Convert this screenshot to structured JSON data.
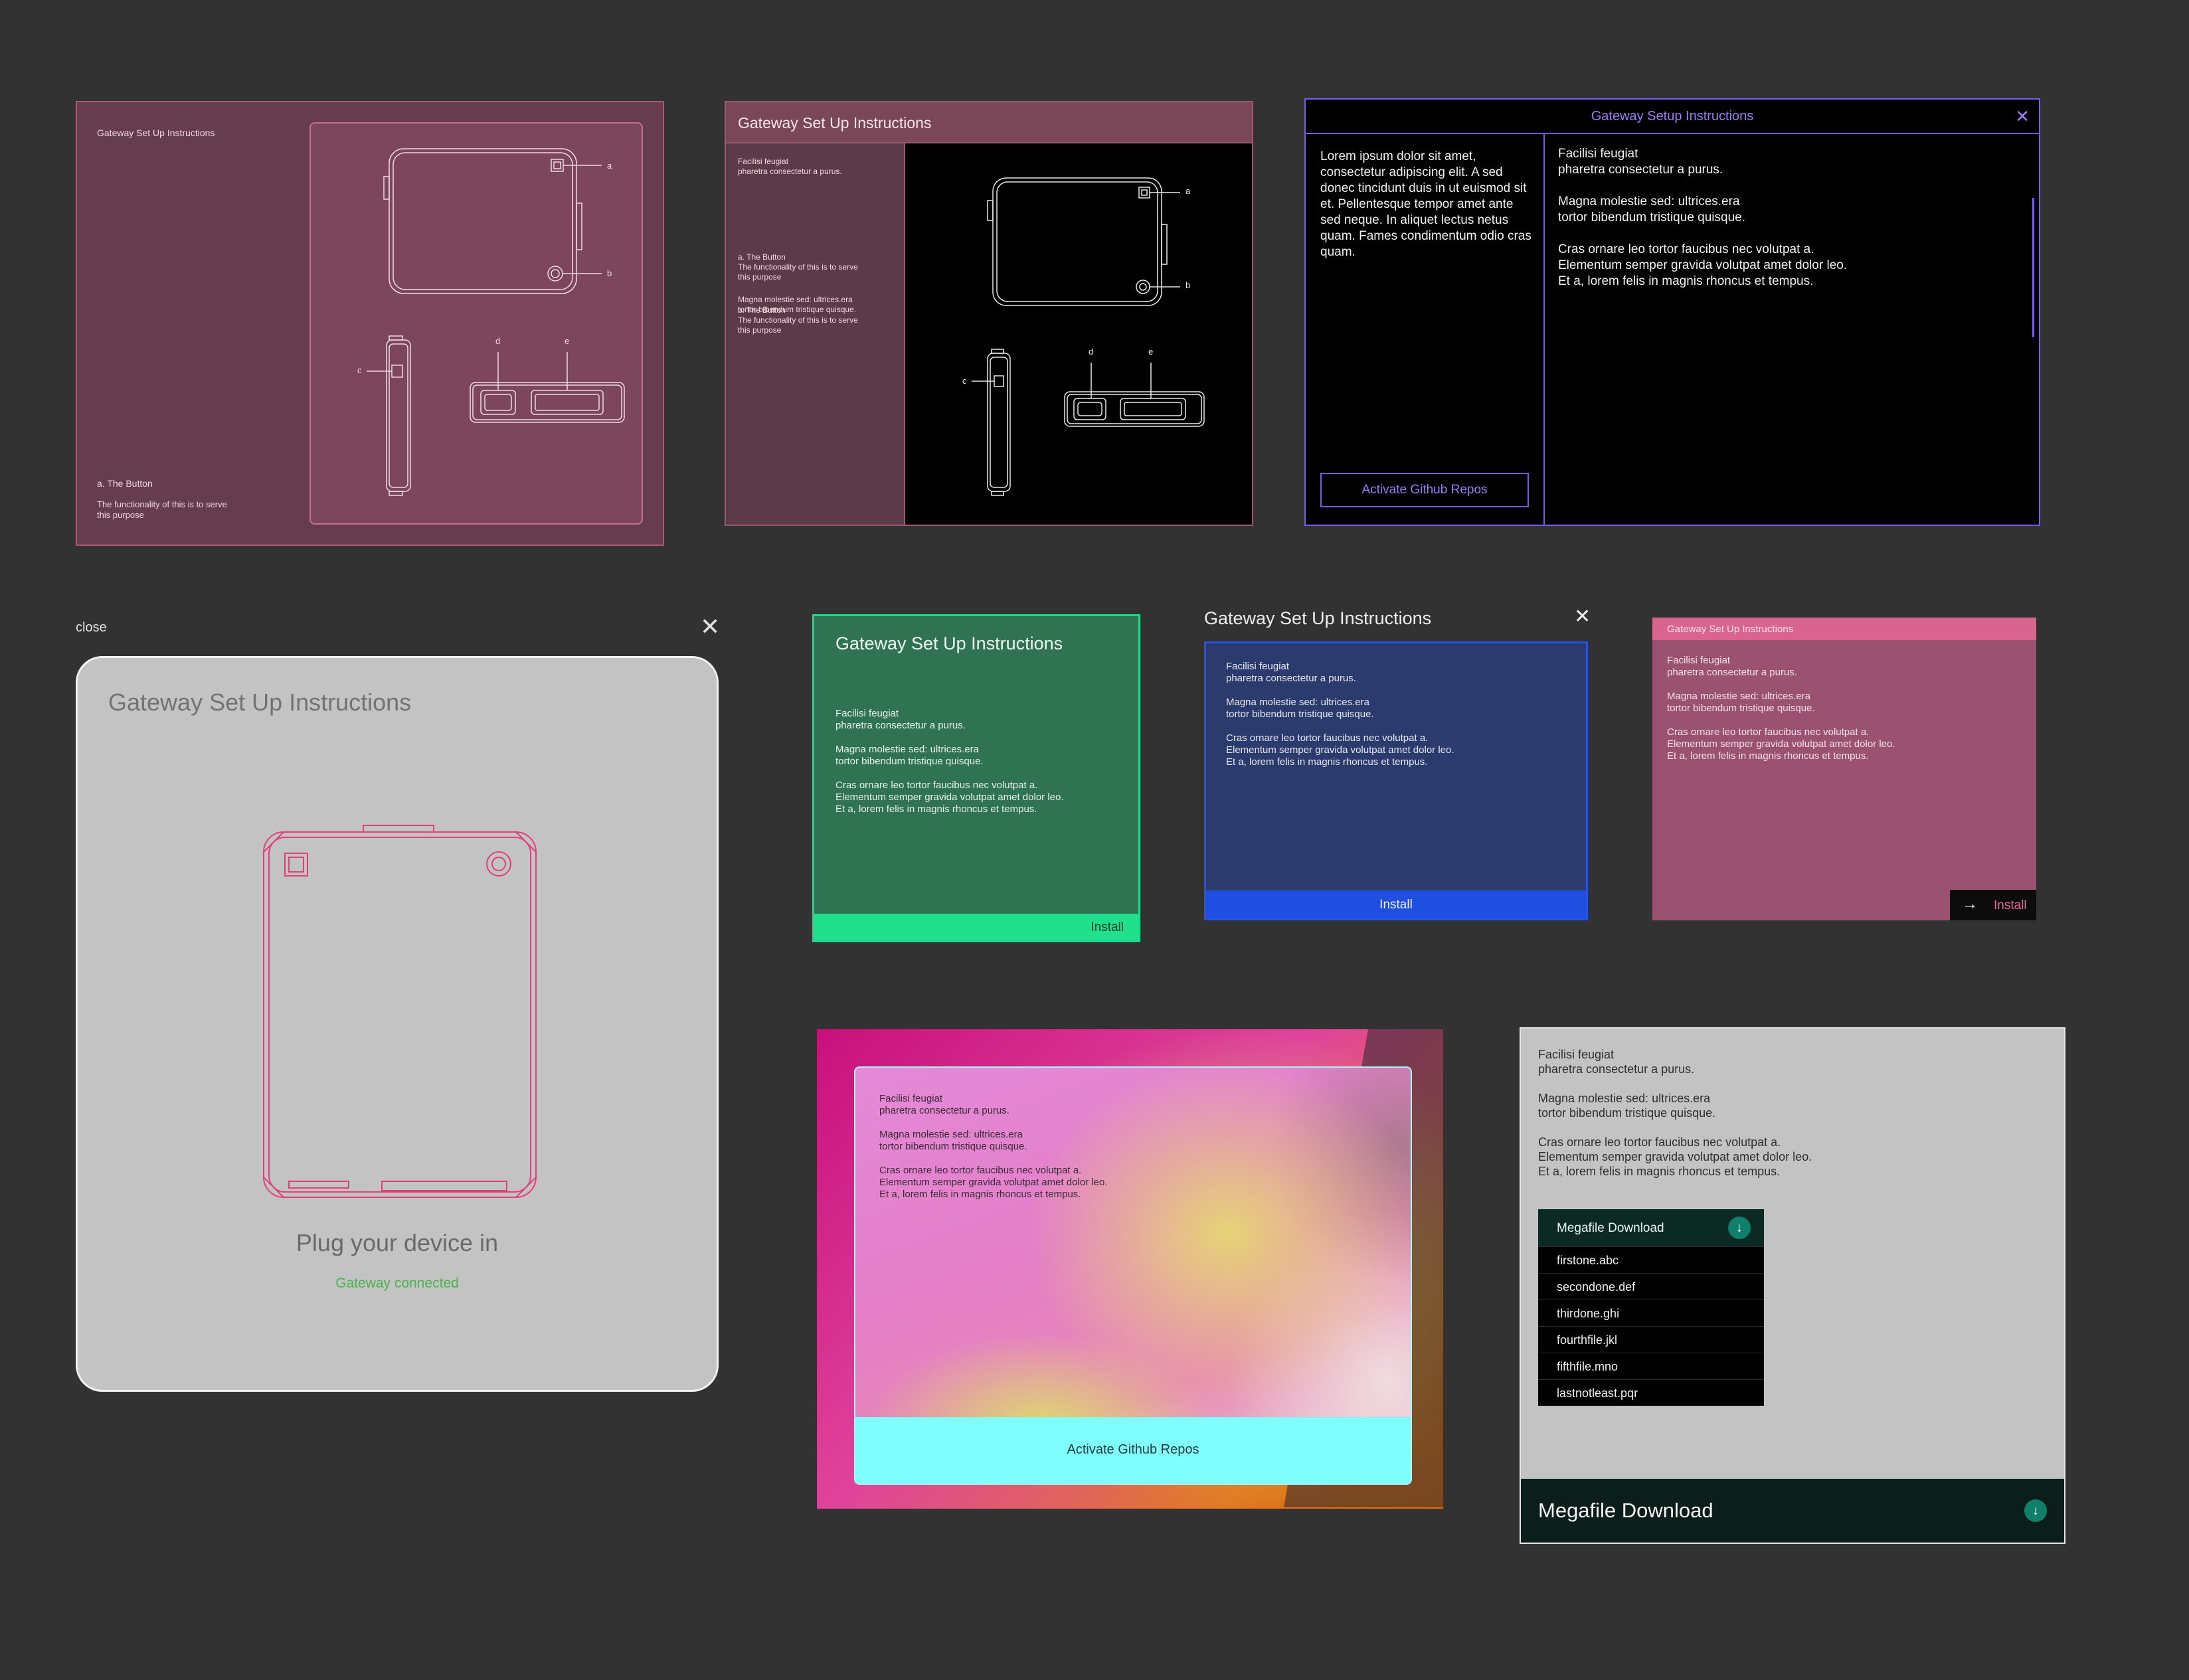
{
  "panel1": {
    "title": "Gateway Set Up Instructions",
    "labels": [
      "a",
      "b",
      "c",
      "d",
      "e"
    ],
    "note_heading": "a. The Button",
    "note_body": "The functionality of this is to serve\nthis purpose"
  },
  "panel2": {
    "title": "Gateway Set Up Instructions",
    "para1": "Facilisi feugiat\npharetra consectetur a purus.",
    "para2": "Magna molestie sed: ultrices.era\ntortor bibendum tristique quisque.",
    "item_a": "a. The Button\nThe functionality of this is to serve\nthis purpose",
    "item_b": "b. The Button\nThe functionality of this is to serve\nthis purpose",
    "labels": [
      "a",
      "b",
      "c",
      "d",
      "e"
    ]
  },
  "panel3": {
    "title": "Gateway Setup Instructions",
    "close_glyph": "✕",
    "left_text": "Lorem ipsum dolor sit amet, consectetur adipiscing elit. A sed donec tincidunt duis in ut euismod sit et. Pellentesque tempor amet ante sed neque. In aliquet lectus netus quam. Fames condimentum odio cras quam.",
    "button": "Activate Github Repos",
    "right_text": "Facilisi feugiat\npharetra consectetur a purus.\n\nMagna molestie sed: ultrices.era\ntortor bibendum tristique quisque.\n\nCras ornare leo tortor faucibus nec volutpat a.\nElementum semper gravida volutpat amet dolor leo.\nEt a, lorem felis in magnis rhoncus et tempus."
  },
  "panel4": {
    "close_label": "close",
    "close_glyph": "✕",
    "title": "Gateway Set Up Instructions",
    "heading": "Plug your device in",
    "status": "Gateway connected",
    "accent": "#e0407a",
    "status_color": "#4cb34c"
  },
  "panel5": {
    "title": "Gateway Set Up Instructions",
    "body": "Facilisi feugiat\npharetra consectetur a purus.\n\nMagna molestie sed: ultrices.era\ntortor bibendum tristique quisque.\n\nCras ornare leo tortor faucibus nec volutpat a.\nElementum semper gravida volutpat amet dolor leo.\nEt a, lorem felis in magnis rhoncus et tempus.",
    "button": "Install",
    "accent": "#1fe08d"
  },
  "panel6": {
    "title": "Gateway Set Up Instructions",
    "close_glyph": "✕",
    "body": "Facilisi feugiat\npharetra consectetur a purus.\n\nMagna molestie sed: ultrices.era\ntortor bibendum tristique quisque.\n\nCras ornare leo tortor faucibus nec volutpat a.\nElementum semper gravida volutpat amet dolor leo.\nEt a, lorem felis in magnis rhoncus et tempus.",
    "button": "Install",
    "accent": "#1f4fe0"
  },
  "panel7": {
    "title": "Gateway Set Up Instructions",
    "body": "Facilisi feugiat\npharetra consectetur a purus.\n\nMagna molestie sed: ultrices.era\ntortor bibendum tristique quisque.\n\nCras ornare leo tortor faucibus nec volutpat a.\nElementum semper gravida volutpat amet dolor leo.\nEt a, lorem felis in magnis rhoncus et tempus.",
    "arrow_glyph": "→",
    "button": "Install",
    "accent": "#d9658e"
  },
  "panel8": {
    "body": "Facilisi feugiat\npharetra consectetur a purus.\n\nMagna molestie sed: ultrices.era\ntortor bibendum tristique quisque.\n\nCras ornare leo tortor faucibus nec volutpat a.\nElementum semper gravida volutpat amet dolor leo.\nEt a, lorem felis in magnis rhoncus et tempus.",
    "button": "Activate Github Repos",
    "accent": "#80ffff"
  },
  "panel9": {
    "body": "Facilisi feugiat\npharetra consectetur a purus.\n\nMagna molestie sed: ultrices.era\ntortor bibendum tristique quisque.\n\nCras ornare leo tortor faucibus nec volutpat a.\nElementum semper gravida volutpat amet dolor leo.\nEt a, lorem felis in magnis rhoncus et tempus.",
    "dropdown": {
      "label": "Megafile Download",
      "icon": "download-icon",
      "icon_glyph": "↓",
      "files": [
        "firstone.abc",
        "secondone.def",
        "thirdone.ghi",
        "fourthfile.jkl",
        "fifthfile.mno",
        "lastnotleast.pqr"
      ]
    },
    "footer": {
      "label": "Megafile Download",
      "icon": "download-icon",
      "icon_glyph": "↓"
    },
    "accent": "#10806a"
  }
}
